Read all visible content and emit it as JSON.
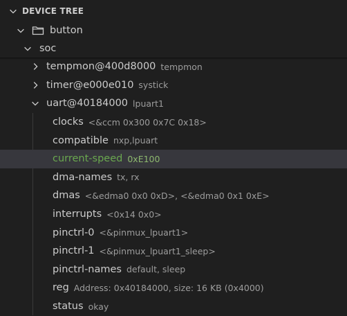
{
  "panel": {
    "title": "DEVICE TREE"
  },
  "tree": {
    "root": {
      "label": "button"
    },
    "soc": {
      "label": "soc"
    },
    "nodes": [
      {
        "label": "tempmon@400d8000",
        "desc": "tempmon"
      },
      {
        "label": "timer@e000e010",
        "desc": "systick"
      },
      {
        "label": "uart@40184000",
        "desc": "lpuart1"
      }
    ],
    "properties": [
      {
        "label": "clocks",
        "desc": "<&ccm 0x300 0x7C 0x18>"
      },
      {
        "label": "compatible",
        "desc": "nxp,lpuart"
      },
      {
        "label": "current-speed",
        "desc": "0xE100",
        "selected": true
      },
      {
        "label": "dma-names",
        "desc": "tx, rx"
      },
      {
        "label": "dmas",
        "desc": "<&edma0 0x0 0xD>, <&edma0 0x1 0xE>"
      },
      {
        "label": "interrupts",
        "desc": "<0x14 0x0>"
      },
      {
        "label": "pinctrl-0",
        "desc": "<&pinmux_lpuart1>"
      },
      {
        "label": "pinctrl-1",
        "desc": "<&pinmux_lpuart1_sleep>"
      },
      {
        "label": "pinctrl-names",
        "desc": "default, sleep"
      },
      {
        "label": "reg",
        "desc": "Address: 0x40184000, size: 16 KB (0x4000)"
      },
      {
        "label": "status",
        "desc": "okay"
      }
    ]
  },
  "colors": {
    "background": "#1f1f1f",
    "selection": "#37373d",
    "selected_text": "#6aa84f",
    "text": "#cccccc",
    "description": "#9d9d9d"
  }
}
